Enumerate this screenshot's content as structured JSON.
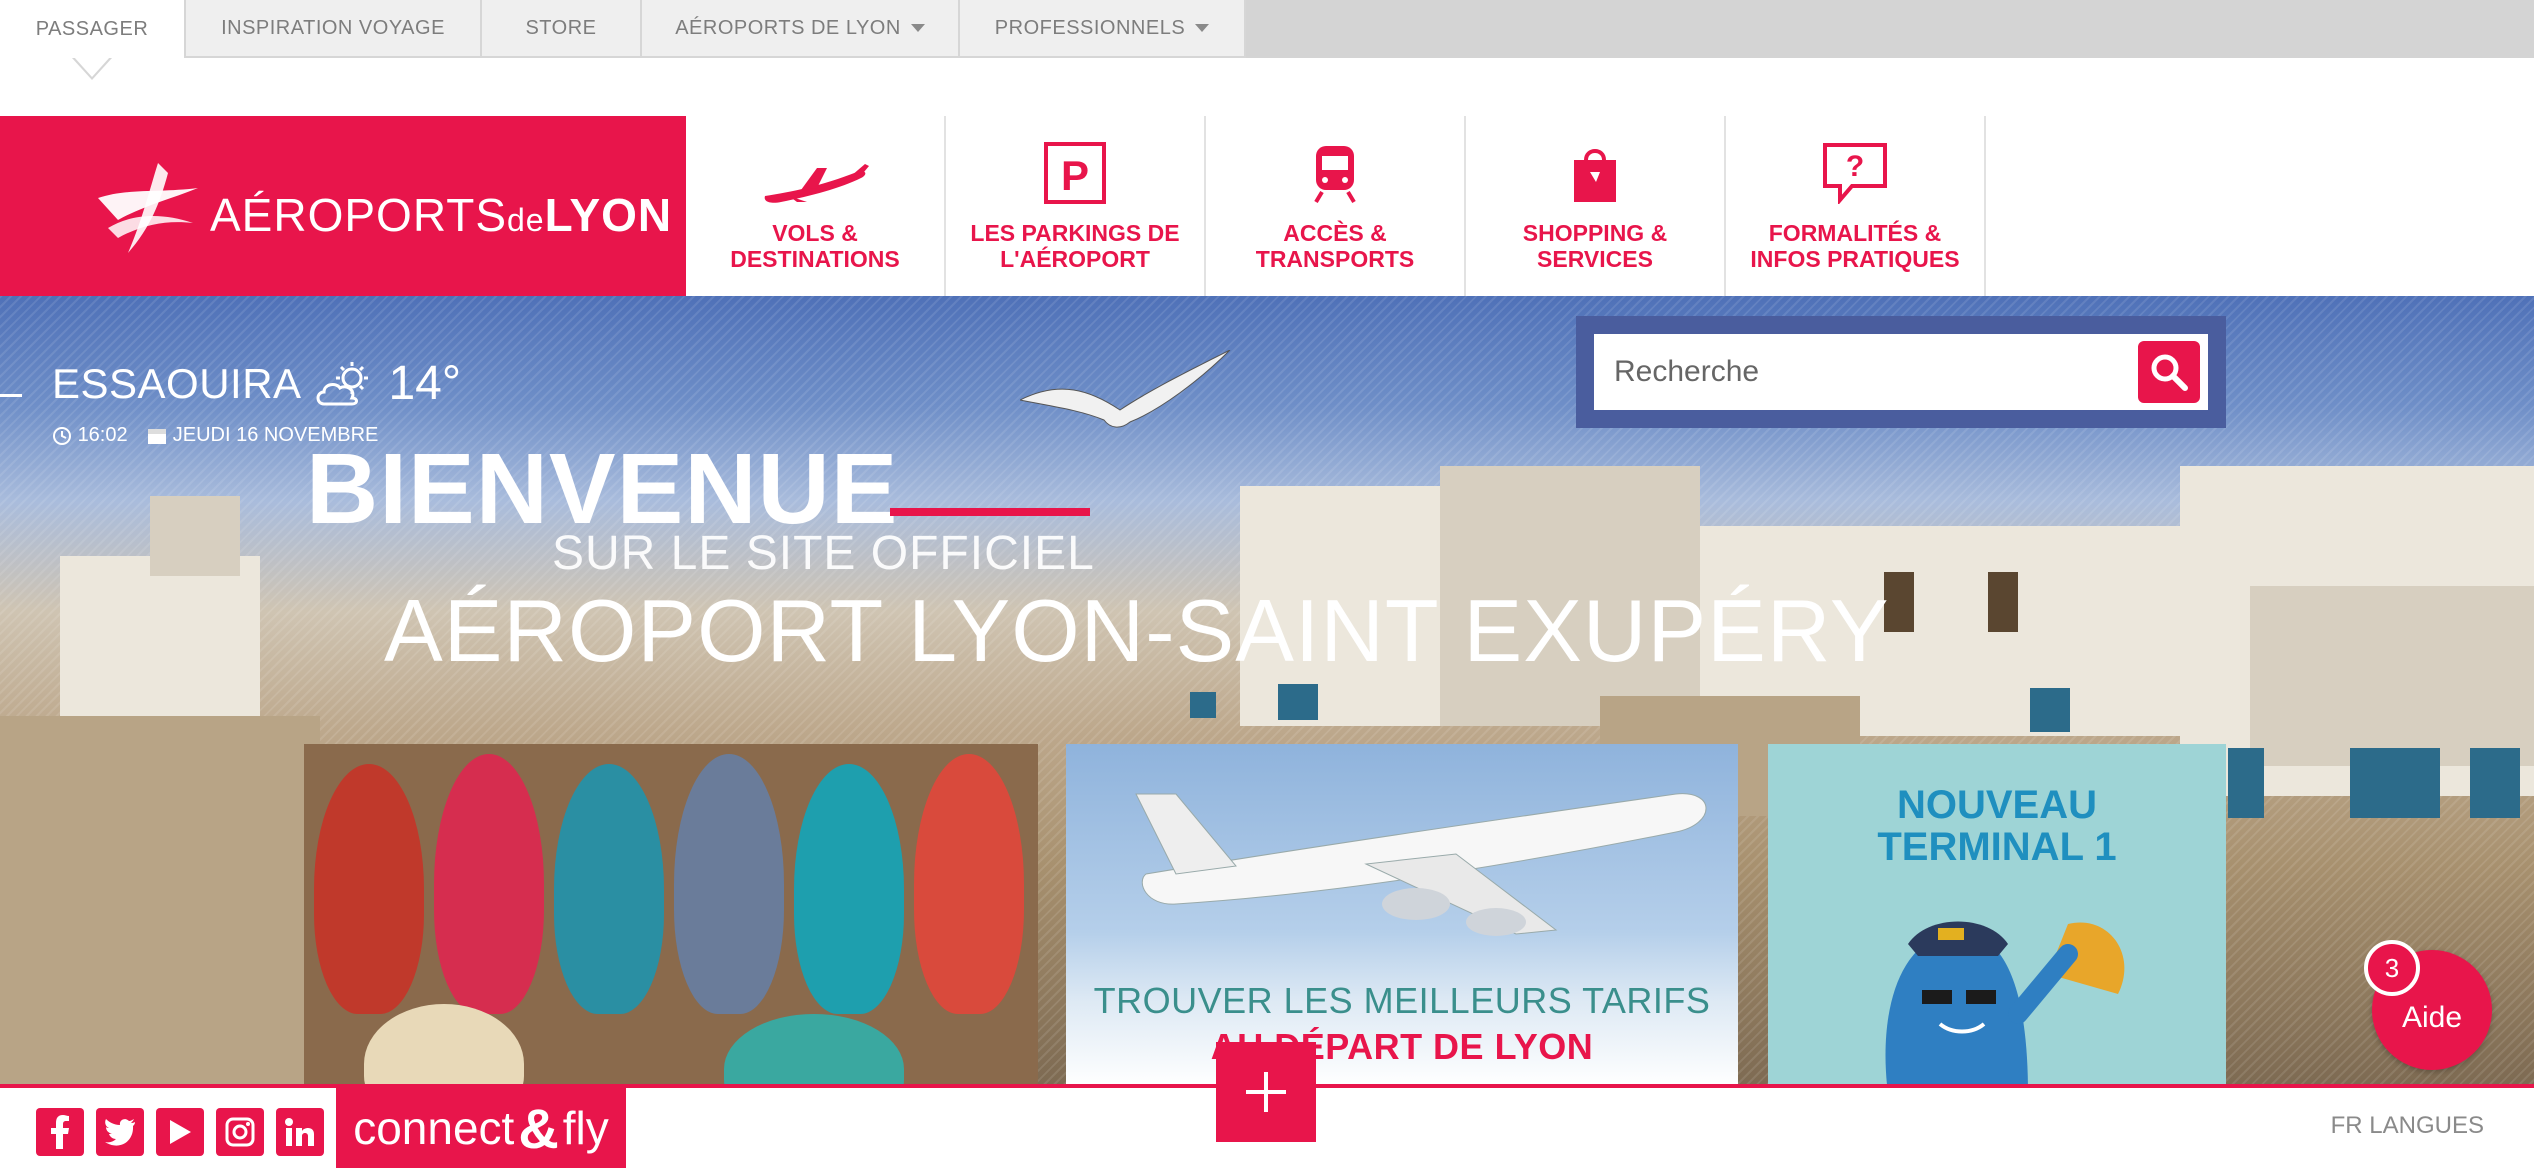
{
  "top_nav": {
    "tabs": [
      {
        "label": "PASSAGER",
        "active": true,
        "dropdown": false
      },
      {
        "label": "INSPIRATION VOYAGE",
        "active": false,
        "dropdown": false
      },
      {
        "label": "STORE",
        "active": false,
        "dropdown": false
      },
      {
        "label": "AÉROPORTS DE LYON",
        "active": false,
        "dropdown": true
      },
      {
        "label": "PROFESSIONNELS",
        "active": false,
        "dropdown": true
      }
    ]
  },
  "logo": {
    "part1": "AÉROPORTS",
    "part2": "de",
    "part3": "LYON"
  },
  "main_nav": [
    {
      "icon": "airplane-icon",
      "label": "VOLS &\nDESTINATIONS"
    },
    {
      "icon": "parking-icon",
      "label": "LES PARKINGS DE\nL'AÉROPORT"
    },
    {
      "icon": "train-icon",
      "label": "ACCÈS &\nTRANSPORTS"
    },
    {
      "icon": "shopping-bag-icon",
      "label": "SHOPPING &\nSERVICES"
    },
    {
      "icon": "question-bubble-icon",
      "label": "FORMALITÉS &\nINFOS PRATIQUES"
    }
  ],
  "weather": {
    "city": "ESSAOUIRA",
    "temperature": "14°",
    "icon": "partly-cloudy-icon",
    "time": "16:02",
    "date": "JEUDI 16 NOVEMBRE"
  },
  "hero": {
    "title": "BIENVENUE",
    "subtitle1": "SUR LE SITE OFFICIEL",
    "subtitle2": "AÉROPORT LYON-SAINT EXUPÉRY"
  },
  "search": {
    "placeholder": "Recherche"
  },
  "cards": {
    "card2_line1": "TROUVER LES MEILLEURS TARIFS",
    "card2_line2": "AU DÉPART DE LYON",
    "card3_title": "NOUVEAU\nTERMINAL 1"
  },
  "aide": {
    "label": "Aide",
    "badge": "3"
  },
  "footer": {
    "social": [
      "facebook-icon",
      "twitter-icon",
      "youtube-icon",
      "instagram-icon",
      "linkedin-icon"
    ],
    "connect_part1": "connect",
    "connect_amp": "&",
    "connect_part2": "fly",
    "language": "FR LANGUES"
  },
  "colors": {
    "brand": "#e8154b",
    "search_frame": "#4a5d9e",
    "card_text": "#3a8f8c"
  }
}
